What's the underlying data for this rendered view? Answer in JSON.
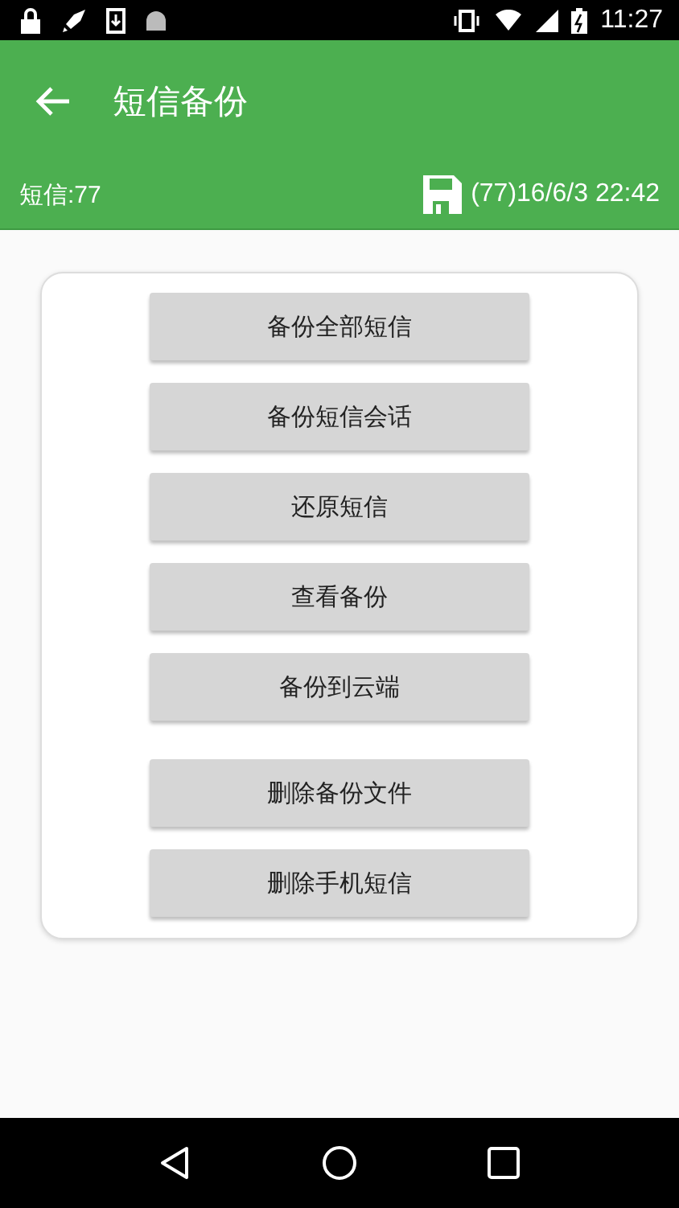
{
  "status_bar": {
    "time": "11:27"
  },
  "toolbar": {
    "title": "短信备份"
  },
  "info_bar": {
    "count": "短信:77",
    "last_backup": "(77)16/6/3 22:42"
  },
  "button_groups": [
    [
      "备份全部短信",
      "备份短信会话",
      "还原短信",
      "查看备份",
      "备份到云端"
    ],
    [
      "删除备份文件",
      "删除手机短信"
    ]
  ]
}
